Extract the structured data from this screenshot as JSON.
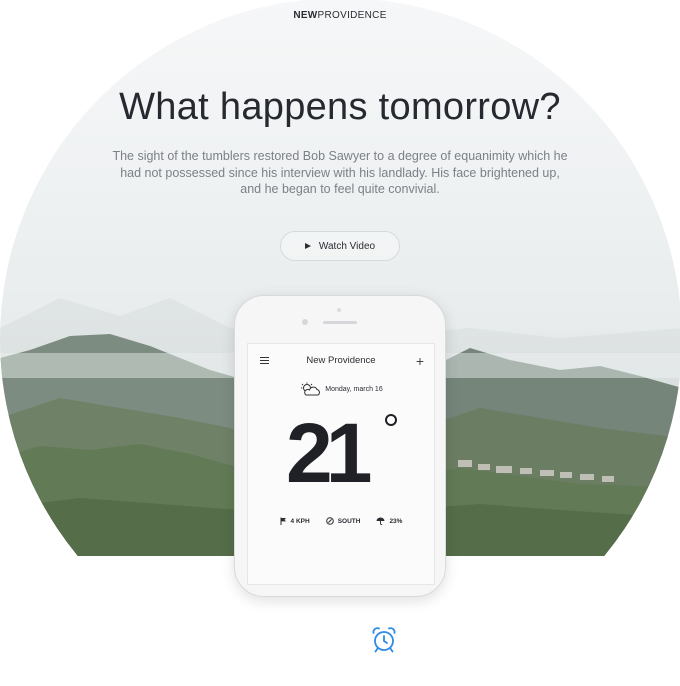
{
  "brand": {
    "bold": "NEW",
    "rest": "PROVIDENCE"
  },
  "hero": {
    "headline": "What happens tomorrow?",
    "lead": "The sight of the tumblers restored Bob Sawyer to a degree of equanimity which he had not possessed since his interview with his landlady. His face brightened up, and he began to feel quite convivial.",
    "watch_label": "Watch Video"
  },
  "app": {
    "title": "New Providence",
    "date": "Monday, march 16",
    "temperature": "21",
    "stats": {
      "wind": "4 KPH",
      "direction": "SOUTH",
      "rain": "23%"
    }
  },
  "icons": {
    "play": "play-icon",
    "menu": "menu-icon",
    "plus": "plus-icon",
    "weather": "partly-cloudy-icon",
    "wind": "flag-icon",
    "compass": "compass-icon",
    "rain": "umbrella-icon",
    "alarm": "alarm-clock-icon"
  },
  "colors": {
    "accent": "#2e8be6",
    "text": "#26292f"
  }
}
